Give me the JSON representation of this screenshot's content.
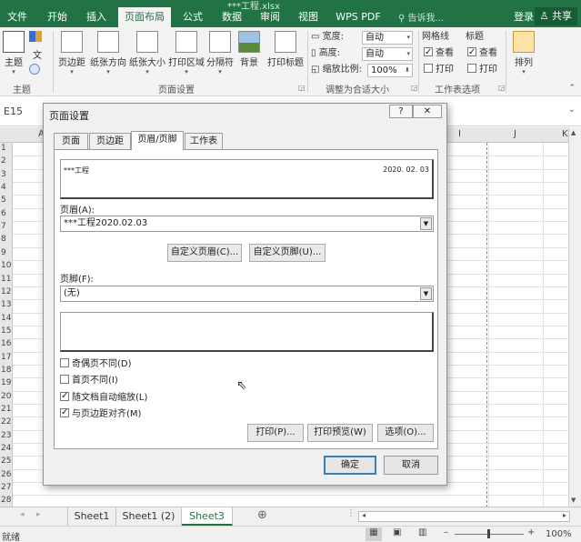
{
  "title": "***工程.xlsx",
  "tabs": [
    {
      "label": "文件"
    },
    {
      "label": "开始"
    },
    {
      "label": "插入"
    },
    {
      "label": "页面布局"
    },
    {
      "label": "公式"
    },
    {
      "label": "数据"
    },
    {
      "label": "审阅"
    },
    {
      "label": "视图"
    },
    {
      "label": "WPS PDF"
    }
  ],
  "tell_me": "告诉我...",
  "login": "登录",
  "share": "共享",
  "ribbon": {
    "theme": {
      "label": "主题",
      "group": "主题"
    },
    "margins": "页边距",
    "orientation": "纸张方向",
    "size": "纸张大小",
    "print_area": "打印区域",
    "breaks": "分隔符",
    "background": "背景",
    "print_titles": "打印标题",
    "page_setup_group": "页面设置",
    "width_label": "宽度:",
    "width_value": "自动",
    "height_label": "高度:",
    "height_value": "自动",
    "scale_label": "缩放比例:",
    "scale_value": "100%",
    "scale_group": "调整为合适大小",
    "gridlines": "网格线",
    "headings": "标题",
    "view": "查看",
    "print": "打印",
    "sheet_options_group": "工作表选项",
    "arrange": "排列"
  },
  "name_box": "E15",
  "columns": [
    "A",
    "I",
    "J",
    "K"
  ],
  "rows": [
    "1",
    "2",
    "3",
    "4",
    "5",
    "6",
    "7",
    "8",
    "9",
    "10",
    "11",
    "12",
    "13",
    "14",
    "15",
    "16",
    "17",
    "18",
    "19",
    "20",
    "21",
    "22",
    "23",
    "24",
    "25",
    "26",
    "27",
    "28"
  ],
  "sheets": [
    "Sheet1",
    "Sheet1 (2)",
    "Sheet3"
  ],
  "active_sheet": "Sheet3",
  "status": {
    "ready": "就绪",
    "zoom": "100%"
  },
  "dialog": {
    "title": "页面设置",
    "help": "?",
    "close": "✕",
    "tabs": [
      "页面",
      "页边距",
      "页眉/页脚",
      "工作表"
    ],
    "active_tab": "页眉/页脚",
    "header_preview_left": "***工程",
    "header_preview_right": "2020. 02. 03",
    "header_label": "页眉(A):",
    "header_value": "***工程2020.02.03",
    "custom_header": "自定义页眉(C)...",
    "custom_footer": "自定义页脚(U)...",
    "footer_label": "页脚(F):",
    "footer_value": "(无)",
    "checks": [
      {
        "label": "奇偶页不同(D)",
        "checked": false
      },
      {
        "label": "首页不同(I)",
        "checked": false
      },
      {
        "label": "随文档自动缩放(L)",
        "checked": true
      },
      {
        "label": "与页边距对齐(M)",
        "checked": true
      }
    ],
    "print": "打印(P)...",
    "print_preview": "打印预览(W)",
    "options": "选项(O)...",
    "ok": "确定",
    "cancel": "取消"
  },
  "colors": {
    "accent": "#217346",
    "dialog_border": "#7a9ab8"
  }
}
